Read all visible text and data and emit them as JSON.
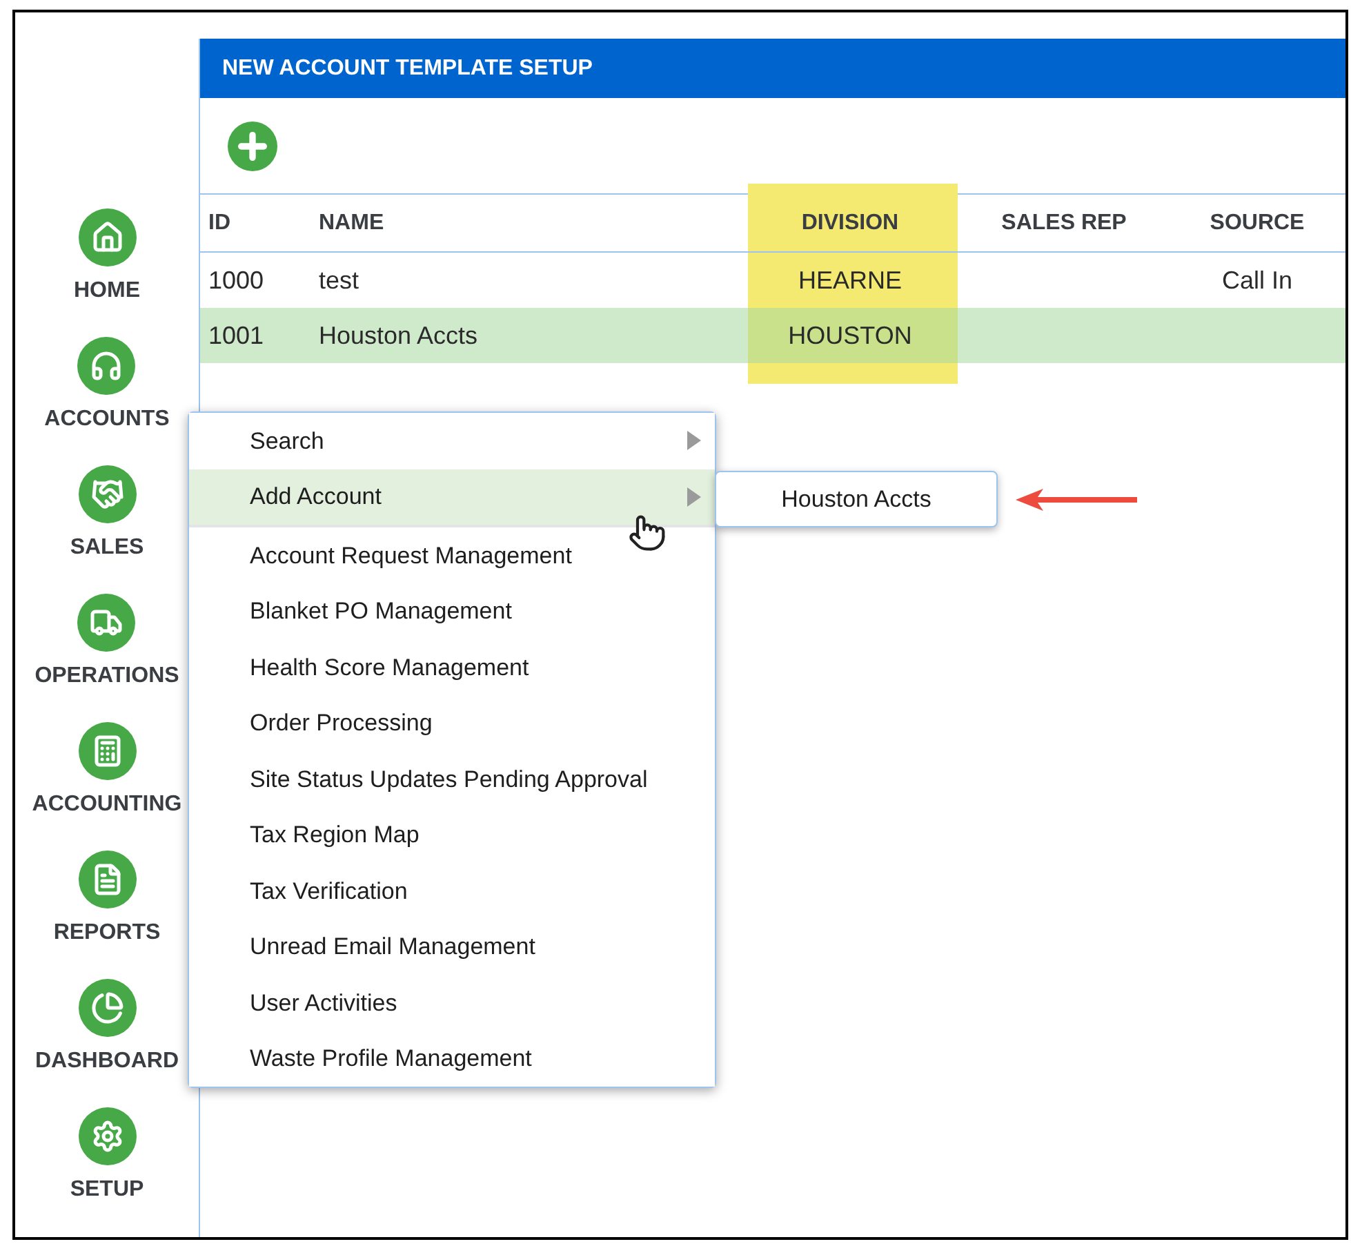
{
  "sidebar": {
    "items": [
      {
        "label": "HOME"
      },
      {
        "label": "ACCOUNTS"
      },
      {
        "label": "SALES"
      },
      {
        "label": "OPERATIONS"
      },
      {
        "label": "ACCOUNTING"
      },
      {
        "label": "REPORTS"
      },
      {
        "label": "DASHBOARD"
      },
      {
        "label": "SETUP"
      }
    ]
  },
  "panel": {
    "title": "NEW ACCOUNT TEMPLATE SETUP"
  },
  "table": {
    "columns": [
      "ID",
      "NAME",
      "DIVISION",
      "SALES REP",
      "SOURCE"
    ],
    "rows": [
      {
        "cells": [
          "1000",
          "test",
          "HEARNE",
          "",
          "Call In"
        ],
        "selected": false
      },
      {
        "cells": [
          "1001",
          "Houston Accts",
          "HOUSTON",
          "",
          ""
        ],
        "selected": true
      }
    ]
  },
  "menu": {
    "groups": [
      [
        {
          "label": "Search",
          "kind": "submenu",
          "selected": false
        },
        {
          "label": "Add Account",
          "kind": "submenu",
          "selected": true
        }
      ],
      [
        {
          "label": "Account Request Management",
          "kind": "item",
          "selected": false
        },
        {
          "label": "Blanket PO Management",
          "kind": "item",
          "selected": false
        },
        {
          "label": "Health Score Management",
          "kind": "item",
          "selected": false
        },
        {
          "label": "Order Processing",
          "kind": "item",
          "selected": false
        },
        {
          "label": "Site Status Updates Pending Approval",
          "kind": "item",
          "selected": false
        },
        {
          "label": "Tax Region Map",
          "kind": "item",
          "selected": false
        },
        {
          "label": "Tax Verification",
          "kind": "item",
          "selected": false
        },
        {
          "label": "Unread Email Management",
          "kind": "item",
          "selected": false
        },
        {
          "label": "User Activities",
          "kind": "item",
          "selected": false
        },
        {
          "label": "Waste Profile Management",
          "kind": "item",
          "selected": false
        }
      ]
    ]
  },
  "submenu": {
    "items": [
      {
        "label": "Houston Accts"
      }
    ]
  }
}
